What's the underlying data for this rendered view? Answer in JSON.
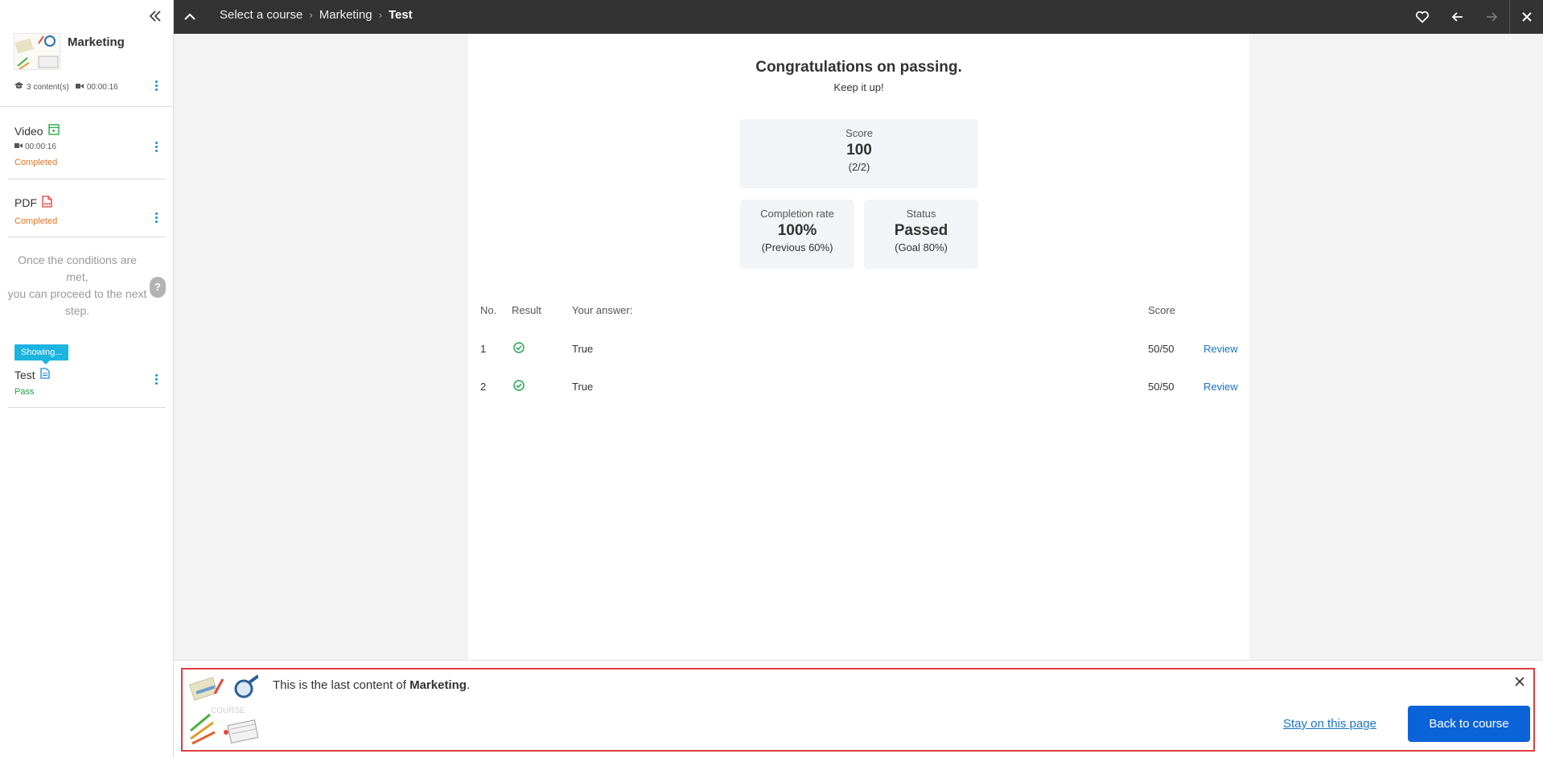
{
  "sidebar": {
    "course": {
      "title": "Marketing",
      "contents": "3 content(s)",
      "duration": "00:00:16"
    },
    "items": [
      {
        "title": "Video",
        "duration": "00:00:16",
        "status": "Completed"
      },
      {
        "title": "PDF",
        "status": "Completed"
      },
      {
        "title": "Test",
        "status": "Pass"
      }
    ],
    "condition_text": "Once the conditions are met,\nyou can proceed to the next step.",
    "help_label": "?",
    "showing_label": "Showing..."
  },
  "topbar": {
    "breadcrumb": [
      "Select a course",
      "Marketing",
      "Test"
    ],
    "separator": "›"
  },
  "result": {
    "title": "Congratulations on passing.",
    "subtitle": "Keep it up!",
    "score": {
      "label": "Score",
      "value": "100",
      "sub": "(2/2)"
    },
    "completion": {
      "label": "Completion rate",
      "value": "100%",
      "sub": "(Previous 60%)"
    },
    "status": {
      "label": "Status",
      "value": "Passed",
      "sub": "(Goal 80%)"
    },
    "table": {
      "headers": {
        "no": "No.",
        "result": "Result",
        "answer": "Your answer:",
        "score": "Score"
      },
      "rows": [
        {
          "no": "1",
          "answer": "True",
          "score": "50/50",
          "review": "Review"
        },
        {
          "no": "2",
          "answer": "True",
          "score": "50/50",
          "review": "Review"
        }
      ]
    }
  },
  "notification": {
    "text_prefix": "This is the last content of ",
    "course_name": "Marketing",
    "text_suffix": ".",
    "image_label": "COURSE",
    "stay_label": "Stay on this page",
    "back_label": "Back to course"
  },
  "colors": {
    "accent": "#0b63d8",
    "link": "#1a73c8",
    "completed": "#e8741e",
    "pass": "#1fa34a",
    "highlight_border": "#e23c3c"
  }
}
